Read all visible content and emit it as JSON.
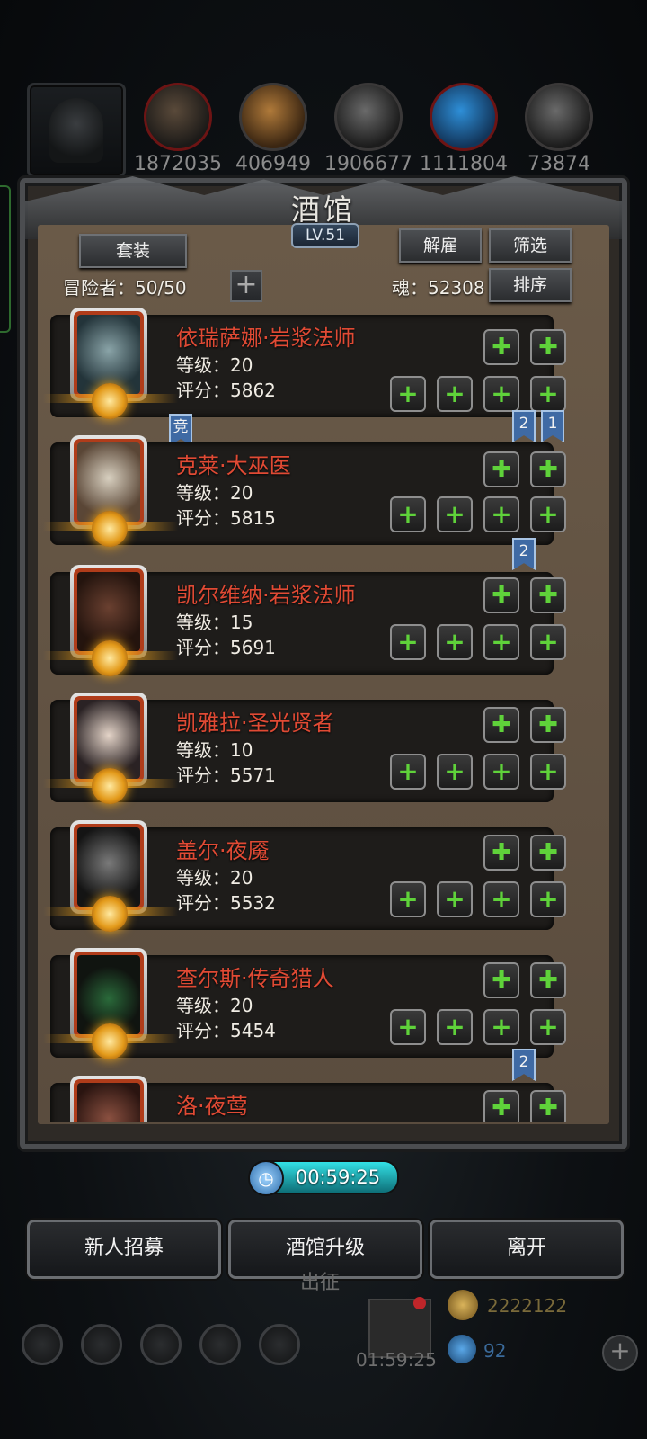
{
  "resources": {
    "values": [
      "1872035",
      "406949",
      "1906677",
      "1111804",
      "73874"
    ]
  },
  "tavern": {
    "title": "酒馆",
    "level": "LV.51",
    "set_button": "套装",
    "dismiss_button": "解雇",
    "filter_button": "筛选",
    "sort_button": "排序",
    "adventurers_label": "冒险者：50/50",
    "soul_label": "魂：52308",
    "add_icon": "+"
  },
  "heroes": [
    {
      "name": "依瑞萨娜·岩浆法师",
      "level": "等级：20",
      "score": "评分：5862",
      "badges": []
    },
    {
      "name": "克莱·大巫医",
      "level": "等级：20",
      "score": "评分：5815",
      "badges": [
        "竞",
        "2",
        "1"
      ]
    },
    {
      "name": "凯尔维纳·岩浆法师",
      "level": "等级：15",
      "score": "评分：5691",
      "badges": [
        "2"
      ]
    },
    {
      "name": "凯雅拉·圣光贤者",
      "level": "等级：10",
      "score": "评分：5571",
      "badges": []
    },
    {
      "name": "盖尔·夜魇",
      "level": "等级：20",
      "score": "评分：5532",
      "badges": []
    },
    {
      "name": "查尔斯·传奇猎人",
      "level": "等级：20",
      "score": "评分：5454",
      "badges": []
    },
    {
      "name": "洛·夜莺",
      "level": "",
      "score": "",
      "badges": [
        "2"
      ]
    }
  ],
  "timer": "00:59:25",
  "bottom_buttons": {
    "recruit": "新人招募",
    "upgrade": "酒馆升级",
    "leave": "离开"
  },
  "hud": {
    "gold": "2222122",
    "gems": "92",
    "gift_timer": "01:59:25",
    "behind_text": "出征"
  },
  "colors": {
    "hero_name": "#e04a34",
    "equip_plus": "#5fd23a",
    "bookmark": "#3f6aa4",
    "timer": "#33e0e4"
  }
}
